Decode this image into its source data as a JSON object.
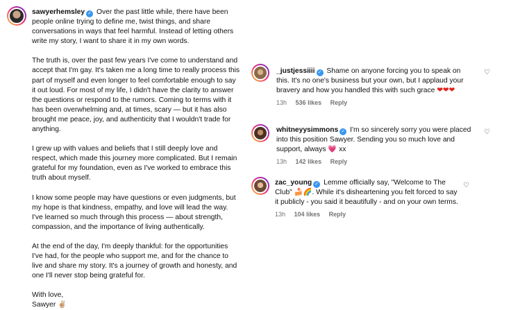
{
  "post": {
    "username": "sawyerhemsley",
    "paragraphs": [
      "Over the past little while, there have been people online trying to define me, twist things, and share conversations in ways that feel harmful. Instead of letting others write my story, I want to share it in my own words.",
      "The truth is, over the past few years I've come to understand and accept that I'm gay. It's taken me a long time to really process this part of myself and even longer to feel comfortable enough to say it out loud. For most of my life, I didn't have the clarity to answer the questions or respond to the rumors. Coming to terms with it has been overwhelming and, at times, scary — but it has also brought me peace, joy, and authenticity that I wouldn't trade for anything.",
      "I grew up with values and beliefs that I still deeply love and respect, which made this journey more complicated. But I remain grateful for my foundation, even as I've worked to embrace this truth about myself.",
      "I know some people may have questions or even judgments, but my hope is that kindness, empathy, and love will lead the way. I've learned so much through this process — about strength, compassion, and the importance of living authentically.",
      "At the end of the day, I'm deeply thankful: for the opportunities I've had, for the people who support me, and for the chance to live and share my story. It's a journey of growth and honesty, and one I'll never stop being grateful for."
    ],
    "signoff_1": "With love,",
    "signoff_2": "Sawyer",
    "signoff_emoji": "✌🏼"
  },
  "comments": [
    {
      "username": "_justjessiiii",
      "text": "Shame on anyone forcing you to speak on this. It's no one's business but your own, but I applaud your bravery and how you handled this with such grace",
      "emoji": "❤❤❤",
      "time": "13h",
      "likes": "536 likes",
      "reply": "Reply"
    },
    {
      "username": "whitneyysimmons",
      "text": "I'm so sincerely sorry you were placed into this position Sawyer. Sending you so much love and support, always",
      "emoji": "💗",
      "tail": "xx",
      "time": "13h",
      "likes": "142 likes",
      "reply": "Reply"
    },
    {
      "username": "zac_young",
      "text": "Lemme officially say, \"Welcome to The Club\"",
      "emoji": "🍰🌈",
      "tail": ". While it's disheartening you felt forced to say it publicly - you said it beautifully - and on your own terms.",
      "time": "13h",
      "likes": "104 likes",
      "reply": "Reply"
    }
  ],
  "icons": {
    "verified": "verified-badge-icon",
    "like": "heart-outline-icon"
  }
}
